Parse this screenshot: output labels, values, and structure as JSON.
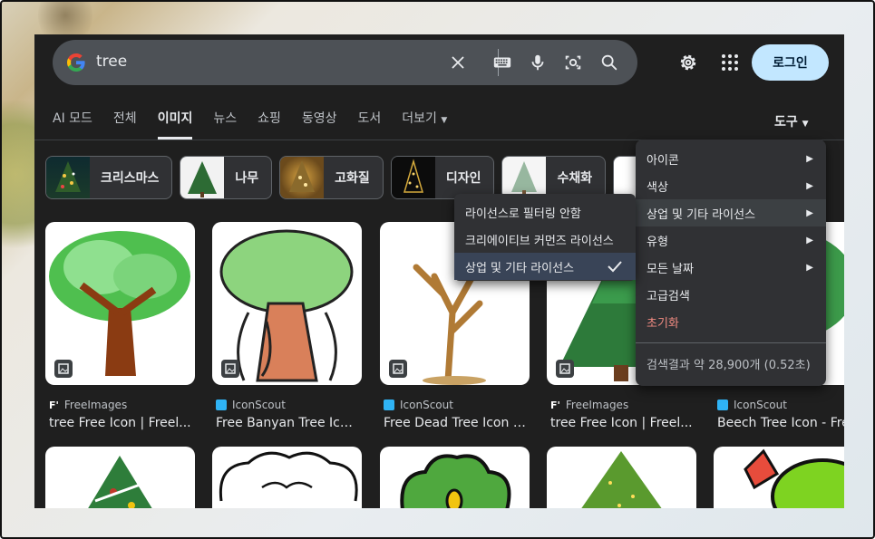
{
  "search": {
    "query": "tree"
  },
  "header": {
    "login_label": "로그인"
  },
  "tabs": [
    {
      "label": "AI 모드"
    },
    {
      "label": "전체"
    },
    {
      "label": "이미지"
    },
    {
      "label": "뉴스"
    },
    {
      "label": "쇼핑"
    },
    {
      "label": "동영상"
    },
    {
      "label": "도서"
    },
    {
      "label": "더보기"
    }
  ],
  "tools_label": "도구",
  "chips": [
    {
      "label": "크리스마스"
    },
    {
      "label": "나무"
    },
    {
      "label": "고화질"
    },
    {
      "label": "디자인"
    },
    {
      "label": "수채화"
    }
  ],
  "results": [
    {
      "source": "FreeImages",
      "title": "tree Free Icon | Freel..."
    },
    {
      "source": "IconScout",
      "title": "Free Banyan Tree Ico..."
    },
    {
      "source": "IconScout",
      "title": "Free Dead Tree Icon -..."
    },
    {
      "source": "FreeImages",
      "title": "tree Free Icon | Freel..."
    },
    {
      "source": "IconScout",
      "title": "Beech Tree Icon - Fre"
    }
  ],
  "tools_menu": {
    "items": [
      {
        "label": "아이콘"
      },
      {
        "label": "색상"
      },
      {
        "label": "상업 및 기타 라이선스"
      },
      {
        "label": "유형"
      },
      {
        "label": "모든 날짜"
      },
      {
        "label": "고급검색"
      },
      {
        "label": "초기화"
      }
    ],
    "result_stats": "검색결과 약 28,900개 (0.52초)"
  },
  "license_submenu": {
    "items": [
      {
        "label": "라이선스로 필터링 안함"
      },
      {
        "label": "크리에이티브 커먼즈 라이선스"
      },
      {
        "label": "상업 및 기타 라이선스"
      }
    ]
  },
  "colors": {
    "background": "#1f1f1f",
    "search_bar": "#4d5156",
    "login_button": "#c2e7ff",
    "reset_text": "#f28b82",
    "selected_item": "#394457"
  }
}
